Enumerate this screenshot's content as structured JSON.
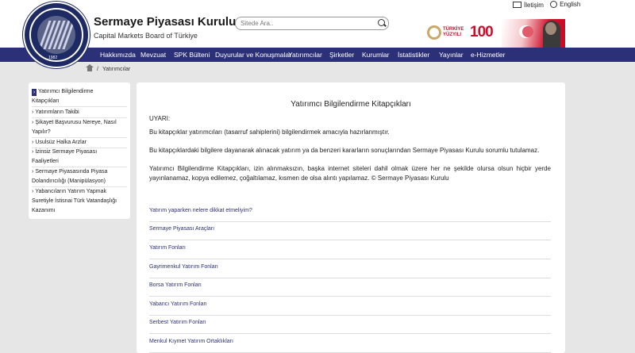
{
  "header": {
    "brand_title": "Sermaye Piyasası Kurulu",
    "brand_subtitle": "Capital Markets Board of Türkiye",
    "logo_ring_text": "SERMAYE PİYASASI KURULU · CAPITAL MARKETS BOARD OF TÜRKİYE",
    "logo_year": "1982",
    "search_placeholder": "Sitede Ara..",
    "contact_label": "İletişim",
    "english_label": "English",
    "turkiye_yuzyili_text": "TÜRKİYE YÜZYILI",
    "hundred_text": "100"
  },
  "nav": {
    "items": [
      "Hakkımızda",
      "Mevzuat",
      "SPK Bülteni",
      "Duyurular ve Konuşmalar",
      "Yatırımcılar",
      "Şirketler",
      "Kurumlar",
      "İstatistikler",
      "Yayınlar",
      "e-Hizmetler"
    ]
  },
  "breadcrumb": {
    "separator": "/",
    "current": "Yatırımcılar"
  },
  "sidebar": {
    "items": [
      {
        "line1": "Yatırımcı Bilgilendirme",
        "line2": "Kitapçıkları"
      },
      {
        "line1": "Yatırımların Takibi",
        "line2": ""
      },
      {
        "line1": "Şikayet Başvurusu Nereye, Nasıl",
        "line2": "Yapılır?"
      },
      {
        "line1": "Usulsüz Halka Arzlar",
        "line2": ""
      },
      {
        "line1": "İzinsiz Sermaye Piyasası",
        "line2": "Faaliyetleri"
      },
      {
        "line1": "Sermaye Piyasasında Piyasa",
        "line2": "Dolandırıcılığı (Manipülasyon)"
      },
      {
        "line1": "Yabancıların Yatırım Yapmak",
        "line2": "Suretiyle İstisnai Türk Vatandaşlığı",
        "line3": "Kazanımı"
      }
    ]
  },
  "main": {
    "title": "Yatırımcı Bilgilendirme Kitapçıkları",
    "warning_label": "UYARI:",
    "paragraph1": "Bu kitapçıklar yatırımcıları (tasarruf sahiplerini) bilgilendirmek amacıyla hazırlanmıştır.",
    "paragraph2": "Bu kitapçıklardaki bilgilere dayanarak alınacak yatırım ya da benzeri kararların sonuçlarından Sermaye Piyasası Kurulu sorumlu tutulamaz.",
    "paragraph3": "Yatırımcı Bilgilendirme Kitapçıkları, izin alınmaksızın, başka internet siteleri dahil olmak üzere her ne şekilde olursa olsun hiçbir yerde yayınlanamaz, kopya edilemez, çoğaltılamaz, kısmen de olsa alıntı yapılamaz. © Sermaye Piyasası Kurulu",
    "links": [
      "Yatırım yaparken nelere dikkat etmeliyim?",
      "Sermaye Piyasası Araçları",
      "Yatırım Fonları",
      "Gayrimenkul Yatırım Fonları",
      "Borsa Yatırım Fonları",
      "Yabancı Yatırım Fonları",
      "Serbest Yatırım Fonları",
      "Menkul Kıymet Yatırım Ortaklıkları"
    ]
  },
  "colors": {
    "nav_bg": "#2c3077",
    "link": "#2c3077",
    "page_bg": "#e6e6e6",
    "accent_red": "#c8102e"
  }
}
